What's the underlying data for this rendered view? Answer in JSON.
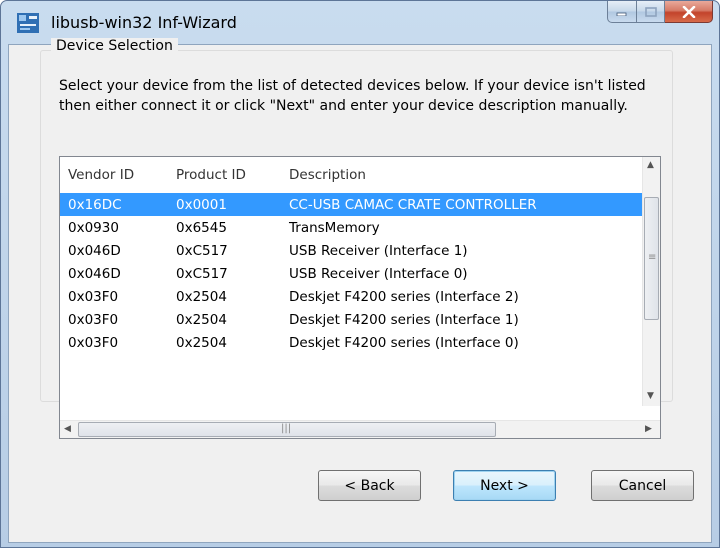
{
  "window": {
    "title": "libusb-win32 Inf-Wizard",
    "icon": "usb-wizard-icon",
    "controls": {
      "minimize": "minimize-icon",
      "maximize": "maximize-icon",
      "close": "close-icon"
    }
  },
  "group": {
    "title": "Device Selection",
    "instructions": "Select your device from the list of detected devices below. If your device isn't listed then either connect it or click \"Next\" and enter your device description manually."
  },
  "device_list": {
    "columns": [
      "Vendor ID",
      "Product ID",
      "Description"
    ],
    "rows": [
      {
        "vendor": "0x16DC",
        "product": "0x0001",
        "description": "CC-USB CAMAC CRATE CONTROLLER",
        "selected": true
      },
      {
        "vendor": "0x0930",
        "product": "0x6545",
        "description": "TransMemory",
        "selected": false
      },
      {
        "vendor": "0x046D",
        "product": "0xC517",
        "description": "USB Receiver (Interface 1)",
        "selected": false
      },
      {
        "vendor": "0x046D",
        "product": "0xC517",
        "description": "USB Receiver (Interface 0)",
        "selected": false
      },
      {
        "vendor": "0x03F0",
        "product": "0x2504",
        "description": "Deskjet F4200 series (Interface 2)",
        "selected": false
      },
      {
        "vendor": "0x03F0",
        "product": "0x2504",
        "description": "Deskjet F4200 series (Interface 1)",
        "selected": false
      },
      {
        "vendor": "0x03F0",
        "product": "0x2504",
        "description": "Deskjet F4200 series (Interface 0)",
        "selected": false
      }
    ]
  },
  "buttons": {
    "back": "< Back",
    "next": "Next >",
    "cancel": "Cancel"
  },
  "colors": {
    "selection": "#3399ff",
    "titlebar": "#b9d1ea",
    "close": "#c7452f"
  }
}
